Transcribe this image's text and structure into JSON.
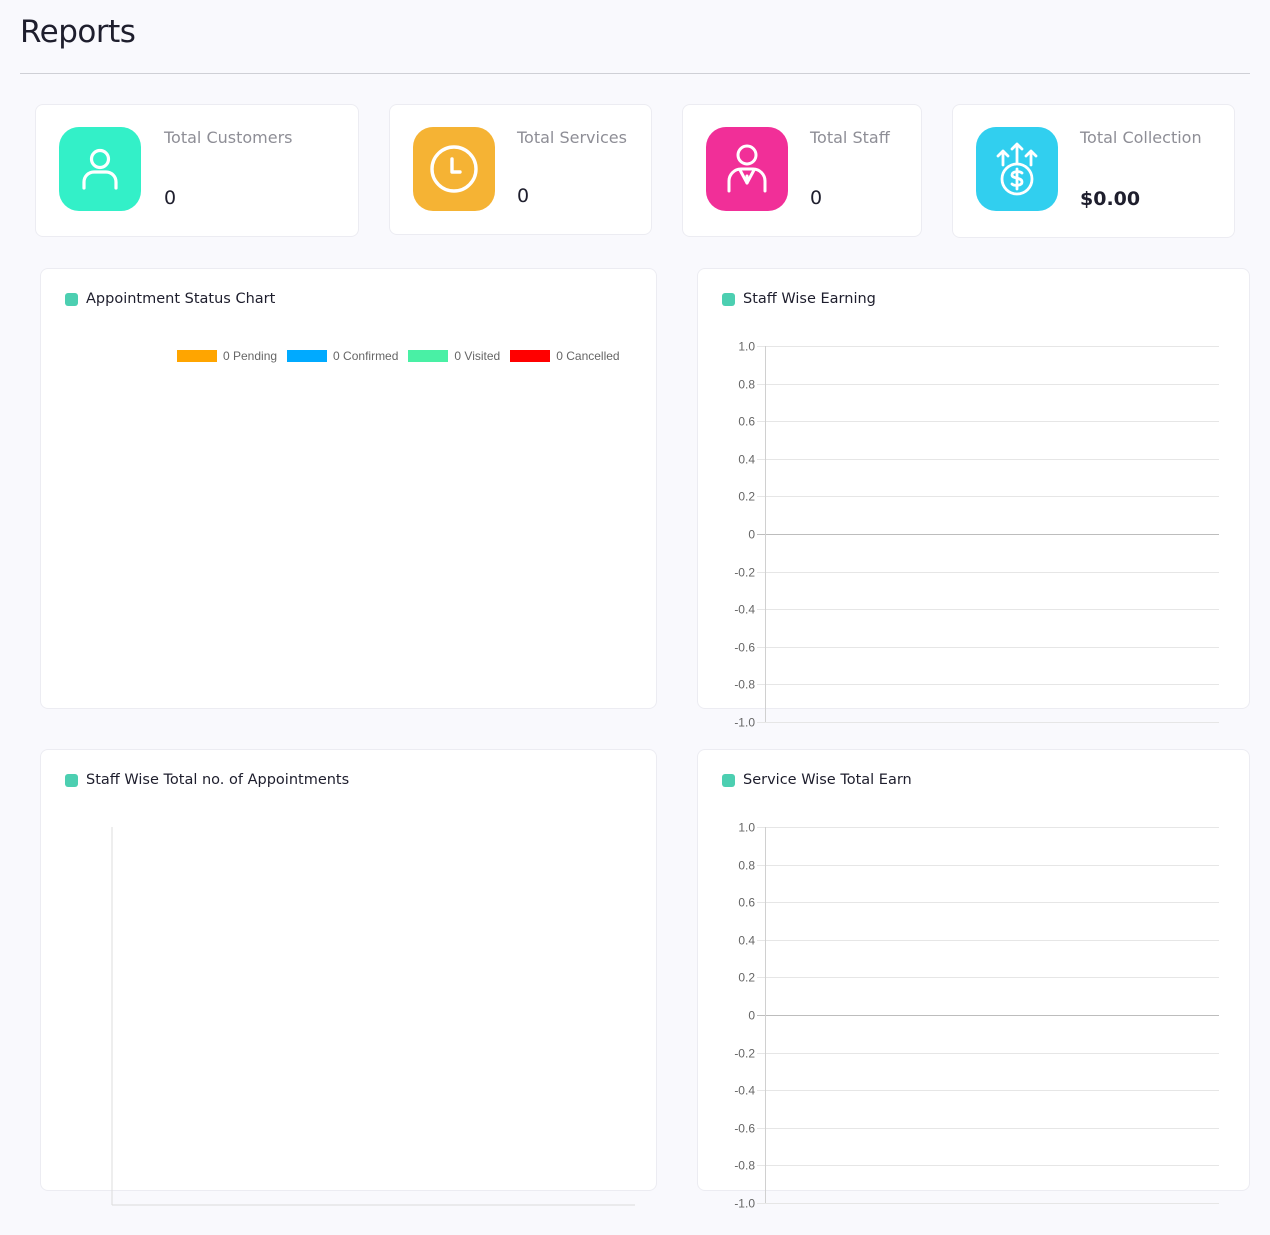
{
  "page": {
    "title": "Reports"
  },
  "stats": [
    {
      "label": "Total Customers",
      "value": "0",
      "icon": "user-icon",
      "color": "#33f0c8"
    },
    {
      "label": "Total Services",
      "value": "0",
      "icon": "clock-icon",
      "color": "#f5b334"
    },
    {
      "label": "Total Staff",
      "value": "0",
      "icon": "staff-icon",
      "color": "#f12f98"
    },
    {
      "label": "Total Collection",
      "value": "$0.00",
      "icon": "money-growth-icon",
      "color": "#31cfef"
    }
  ],
  "panels": {
    "appointment_status": {
      "title": "Appointment Status Chart",
      "legend": [
        {
          "label": "0 Pending",
          "color": "#ffa500"
        },
        {
          "label": "0 Confirmed",
          "color": "#00aaff"
        },
        {
          "label": "0 Visited",
          "color": "#49f0a5"
        },
        {
          "label": "0 Cancelled",
          "color": "#ff0000"
        }
      ]
    },
    "staff_earning": {
      "title": "Staff Wise Earning"
    },
    "staff_appointments": {
      "title": "Staff Wise Total no. of Appointments"
    },
    "service_earn": {
      "title": "Service Wise Total Earn"
    }
  },
  "chart_data": [
    {
      "type": "bar",
      "title": "Appointment Status Chart",
      "series": [
        {
          "name": "0 Pending",
          "values": [
            0
          ]
        },
        {
          "name": "0 Confirmed",
          "values": [
            0
          ]
        },
        {
          "name": "0 Visited",
          "values": [
            0
          ]
        },
        {
          "name": "0 Cancelled",
          "values": [
            0
          ]
        }
      ],
      "legend": "top"
    },
    {
      "type": "bar",
      "title": "Staff Wise Earning",
      "categories": [],
      "values": [],
      "ylim": [
        -1.0,
        1.0
      ],
      "yticks": [
        "1.0",
        "0.8",
        "0.6",
        "0.4",
        "0.2",
        "0",
        "-0.2",
        "-0.4",
        "-0.6",
        "-0.8",
        "-1.0"
      ],
      "grid": true
    },
    {
      "type": "bar",
      "title": "Staff Wise Total no. of Appointments",
      "categories": [],
      "values": [],
      "grid": false
    },
    {
      "type": "bar",
      "title": "Service Wise Total Earn",
      "categories": [],
      "values": [],
      "ylim": [
        -1.0,
        1.0
      ],
      "yticks": [
        "1.0",
        "0.8",
        "0.6",
        "0.4",
        "0.2",
        "0",
        "-0.2",
        "-0.4",
        "-0.6",
        "-0.8",
        "-1.0"
      ],
      "grid": true
    }
  ]
}
